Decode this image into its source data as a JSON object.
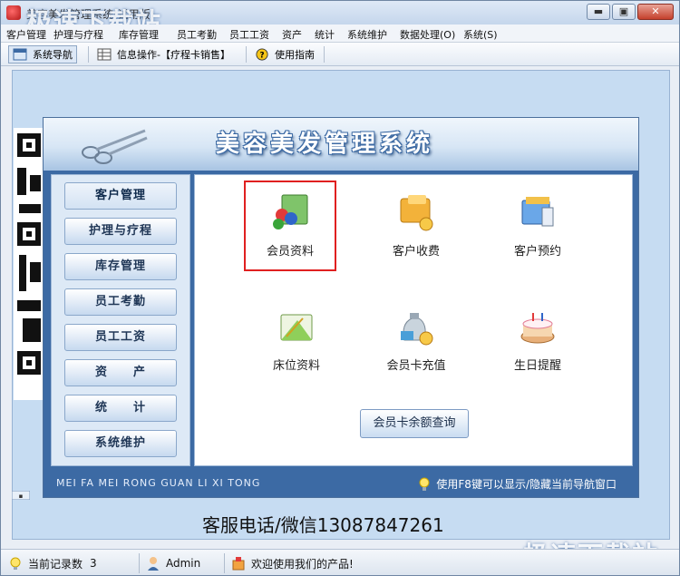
{
  "window": {
    "title": "美容美发管理系统(试用版)",
    "watermark_top": "极速下载站",
    "watermark_bottom": "极速下载站",
    "buttons": {
      "minimize": "▬",
      "maximize": "▣",
      "close": "✕"
    }
  },
  "menu": [
    "客户管理",
    "护理与疗程",
    "库存管理",
    "员工考勤",
    "员工工资",
    "资产",
    "统计",
    "系统维护",
    "数据处理(O)",
    "系统(S)"
  ],
  "toolbar": {
    "items": [
      {
        "label": "系统导航",
        "icon": "nav-window-icon",
        "active": true
      },
      {
        "label": "信息操作-【疗程卡销售】",
        "icon": "grid-table-icon",
        "active": false
      },
      {
        "label": "使用指南",
        "icon": "help-icon",
        "active": false
      }
    ]
  },
  "panel": {
    "title": "美容美发管理系统",
    "footer_pinyin": "MEI FA MEI RONG GUAN LI XI TONG",
    "footer_tip": "使用F8键可以显示/隐藏当前导航窗口"
  },
  "side_buttons": [
    "客户管理",
    "护理与疗程",
    "库存管理",
    "员工考勤",
    "员工工资",
    "资　　产",
    "统　　计",
    "系统维护"
  ],
  "functions": [
    {
      "label": "会员资料",
      "icon": "member-info-icon",
      "selected": true
    },
    {
      "label": "客户收费",
      "icon": "customer-charge-icon",
      "selected": false
    },
    {
      "label": "客户预约",
      "icon": "customer-booking-icon",
      "selected": false
    },
    {
      "label": "床位资料",
      "icon": "bed-info-icon",
      "selected": false
    },
    {
      "label": "会员卡充值",
      "icon": "card-recharge-icon",
      "selected": false
    },
    {
      "label": "生日提醒",
      "icon": "birthday-reminder-icon",
      "selected": false
    }
  ],
  "query_button": "会员卡余额查询",
  "service_line": "客服电话/微信13087847261",
  "status": {
    "record_count_label": "当前记录数",
    "record_count": "3",
    "user": "Admin",
    "welcome": "欢迎使用我们的产品!"
  },
  "colors": {
    "accent": "#3c6aa4",
    "selected_border": "#e02020",
    "workspace": "#c6dcf2"
  }
}
